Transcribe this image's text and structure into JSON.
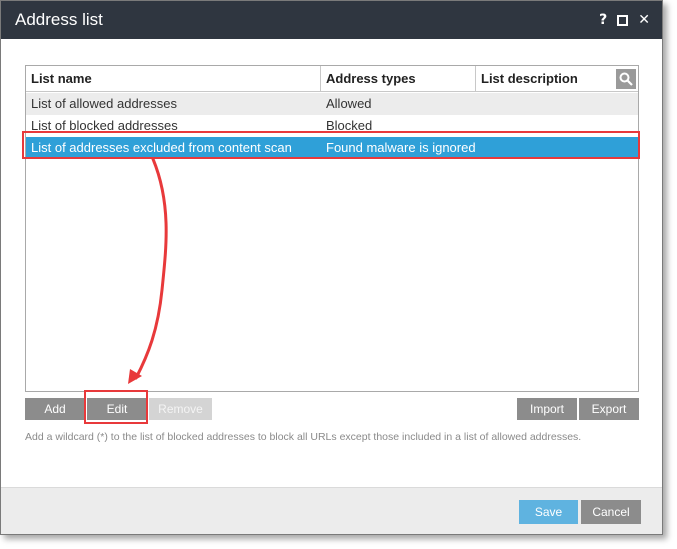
{
  "window": {
    "title": "Address list",
    "help_glyph": "?",
    "close_glyph": "✕"
  },
  "table": {
    "columns": [
      "List name",
      "Address types",
      "List description"
    ],
    "rows": [
      {
        "name": "List of allowed addresses",
        "type": "Allowed",
        "description": ""
      },
      {
        "name": "List of blocked addresses",
        "type": "Blocked",
        "description": ""
      },
      {
        "name": "List of addresses excluded from content scan",
        "type": "Found malware is ignored",
        "description": "",
        "selected": true
      }
    ]
  },
  "toolbar": {
    "add_label": "Add",
    "edit_label": "Edit",
    "remove_label": "Remove",
    "import_label": "Import",
    "export_label": "Export"
  },
  "hint_text": "Add a wildcard (*) to the list of blocked addresses to block all URLs except those included in a list of allowed addresses.",
  "footer": {
    "save_label": "Save",
    "cancel_label": "Cancel"
  },
  "colors": {
    "titlebar": "#2f3640",
    "selection": "#2fa0d8",
    "annotation": "#e8393b",
    "primary_button": "#5fb3e0",
    "secondary_button": "#8c8c8c"
  }
}
